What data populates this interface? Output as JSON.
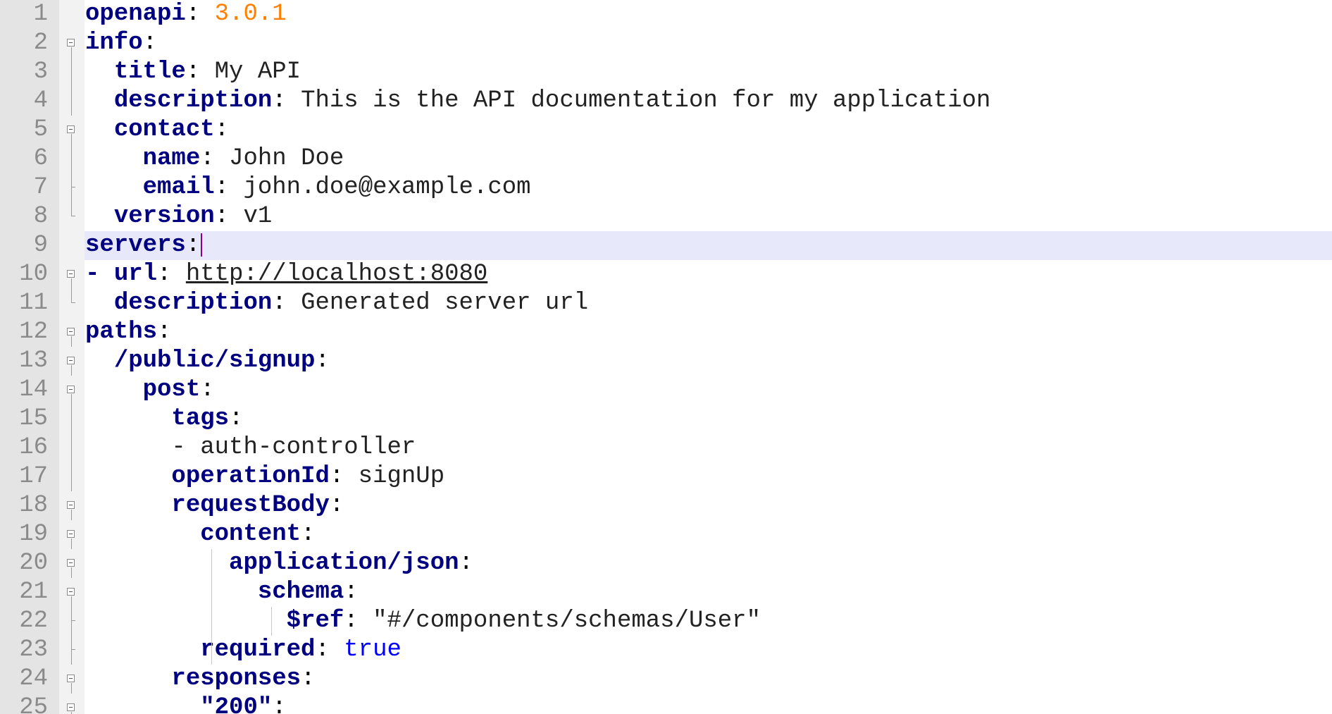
{
  "editor": {
    "language": "yaml",
    "current_line": 9,
    "colors": {
      "key": "#000080",
      "number": "#ff8000",
      "boolean": "#0000ff",
      "current_line_bg": "#e8e8fb",
      "gutter_bg": "#e4e4e4"
    },
    "lines": [
      {
        "n": "1",
        "indent": "",
        "key": "openapi",
        "sep": ": ",
        "value": "3.0.1",
        "vclass": "num"
      },
      {
        "n": "2",
        "indent": "",
        "key": "info",
        "sep": ":",
        "value": "",
        "vclass": "v"
      },
      {
        "n": "3",
        "indent": "  ",
        "key": "title",
        "sep": ": ",
        "value": "My API",
        "vclass": "v"
      },
      {
        "n": "4",
        "indent": "  ",
        "key": "description",
        "sep": ": ",
        "value": "This is the API documentation for my application",
        "vclass": "v"
      },
      {
        "n": "5",
        "indent": "  ",
        "key": "contact",
        "sep": ":",
        "value": "",
        "vclass": "v"
      },
      {
        "n": "6",
        "indent": "    ",
        "key": "name",
        "sep": ": ",
        "value": "John Doe",
        "vclass": "v"
      },
      {
        "n": "7",
        "indent": "    ",
        "key": "email",
        "sep": ": ",
        "value": "john.doe@example.com",
        "vclass": "v"
      },
      {
        "n": "8",
        "indent": "  ",
        "key": "version",
        "sep": ": ",
        "value": "v1",
        "vclass": "v"
      },
      {
        "n": "9",
        "indent": "",
        "key": "servers",
        "sep": ":",
        "value": "",
        "vclass": "v"
      },
      {
        "n": "10",
        "indent": "",
        "dash": "- ",
        "key": "url",
        "sep": ": ",
        "value": "http://localhost:8080",
        "vclass": "u"
      },
      {
        "n": "11",
        "indent": "  ",
        "key": "description",
        "sep": ": ",
        "value": "Generated server url",
        "vclass": "v"
      },
      {
        "n": "12",
        "indent": "",
        "key": "paths",
        "sep": ":",
        "value": "",
        "vclass": "v"
      },
      {
        "n": "13",
        "indent": "  ",
        "key": "/public/signup",
        "sep": ":",
        "value": "",
        "vclass": "v"
      },
      {
        "n": "14",
        "indent": "    ",
        "key": "post",
        "sep": ":",
        "value": "",
        "vclass": "v"
      },
      {
        "n": "15",
        "indent": "      ",
        "key": "tags",
        "sep": ":",
        "value": "",
        "vclass": "v"
      },
      {
        "n": "16",
        "indent": "      ",
        "key": "",
        "sep": "",
        "value": "- auth-controller",
        "vclass": "v"
      },
      {
        "n": "17",
        "indent": "      ",
        "key": "operationId",
        "sep": ": ",
        "value": "signUp",
        "vclass": "v"
      },
      {
        "n": "18",
        "indent": "      ",
        "key": "requestBody",
        "sep": ":",
        "value": "",
        "vclass": "v"
      },
      {
        "n": "19",
        "indent": "        ",
        "key": "content",
        "sep": ":",
        "value": "",
        "vclass": "v"
      },
      {
        "n": "20",
        "indent": "          ",
        "key": "application/json",
        "sep": ":",
        "value": "",
        "vclass": "v"
      },
      {
        "n": "21",
        "indent": "            ",
        "key": "schema",
        "sep": ":",
        "value": "",
        "vclass": "v"
      },
      {
        "n": "22",
        "indent": "              ",
        "key": "$ref",
        "sep": ": ",
        "value": "\"#/components/schemas/User\"",
        "vclass": "v"
      },
      {
        "n": "23",
        "indent": "        ",
        "key": "required",
        "sep": ": ",
        "value": "true",
        "vclass": "bool"
      },
      {
        "n": "24",
        "indent": "      ",
        "key": "responses",
        "sep": ":",
        "value": "",
        "vclass": "v"
      },
      {
        "n": "25",
        "indent": "        ",
        "key": "\"200\"",
        "sep": ":",
        "value": "",
        "vclass": "v"
      }
    ]
  }
}
